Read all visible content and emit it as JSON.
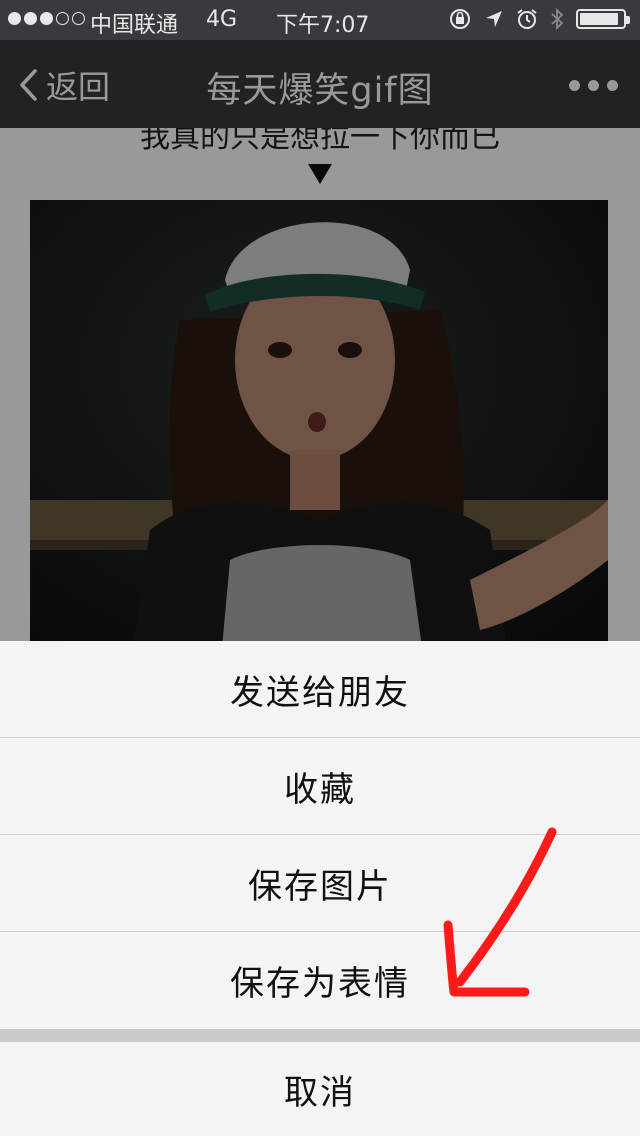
{
  "status_bar": {
    "carrier": "中国联通",
    "network": "4G",
    "time": "下午7:07",
    "battery_level": 0.9
  },
  "nav": {
    "back_label": "返回",
    "title": "每天爆笑gif图"
  },
  "content": {
    "caption": "我真的只是想拉一下你而已"
  },
  "action_sheet": {
    "items": [
      {
        "label": "发送给朋友"
      },
      {
        "label": "收藏"
      },
      {
        "label": "保存图片"
      },
      {
        "label": "保存为表情"
      }
    ],
    "cancel_label": "取消"
  },
  "colors": {
    "nav_background": "#393a3f",
    "annotation_red": "#ff1a1a"
  }
}
